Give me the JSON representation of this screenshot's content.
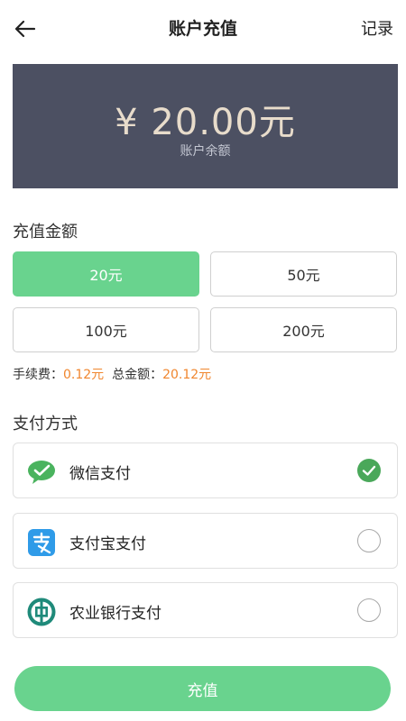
{
  "header": {
    "title": "账户充值",
    "record_label": "记录"
  },
  "balance": {
    "amount": "¥ 20.00元",
    "label": "账户余额"
  },
  "recharge": {
    "section_title": "充值金额",
    "options": [
      {
        "label": "20元",
        "selected": true
      },
      {
        "label": "50元",
        "selected": false
      },
      {
        "label": "100元",
        "selected": false
      },
      {
        "label": "200元",
        "selected": false
      }
    ],
    "fee_label": "手续费：",
    "fee_value": "0.12元",
    "total_label": "总金额：",
    "total_value": "20.12元"
  },
  "payment": {
    "section_title": "支付方式",
    "methods": [
      {
        "label": "微信支付",
        "icon": "wechat-pay-icon",
        "checked": true
      },
      {
        "label": "支付宝支付",
        "icon": "alipay-icon",
        "checked": false
      },
      {
        "label": "农业银行支付",
        "icon": "abc-bank-icon",
        "checked": false
      }
    ]
  },
  "submit_label": "充值",
  "colors": {
    "accent_green": "#69d38e",
    "check_green": "#4aa85a",
    "fee_orange": "#f0862e",
    "balance_bg": "#4c5062",
    "balance_text": "#e8dccb",
    "alipay_blue": "#2f9be8",
    "abc_teal": "#1f8a7a"
  }
}
